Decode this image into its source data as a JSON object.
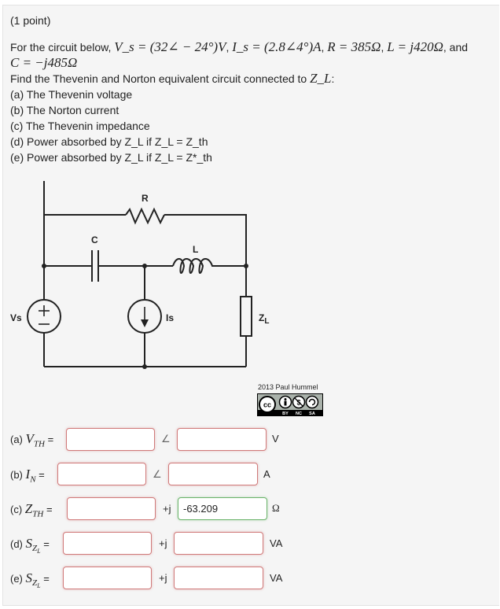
{
  "problem": {
    "points": "(1 point)",
    "intro_text": "For the circuit below,",
    "given": {
      "Vs": "V_s = (32∠ − 24°)V",
      "Is": "I_s = (2.8∠4°)A",
      "R": "R = 385Ω",
      "L": "L = j420Ω",
      "C": "C = −j485Ω",
      "and": "and"
    },
    "find_text": "Find the Thevenin and Norton equivalent circuit connected to",
    "find_target": "Z_L",
    "tasks": [
      "(a) The Thevenin voltage",
      "(b) The Norton current",
      "(c) The Thevenin impedance",
      "(d) Power absorbed by Z_L if Z_L = Z_th",
      "(e) Power absorbed by Z_L if Z_L = Z*_th"
    ]
  },
  "circuit": {
    "labels": {
      "R": "R",
      "C": "C",
      "L": "L",
      "Vs": "Vs",
      "Is": "Is",
      "ZL": "Z",
      "ZL_sub": "L"
    },
    "credit": "2013 Paul Hummel",
    "license": {
      "cc": "cc",
      "by": "BY",
      "nc": "NC",
      "sa": "SA"
    }
  },
  "answers": [
    {
      "prefix": "(a)",
      "symbol": "V",
      "sub": "TH",
      "eq": "=",
      "sep": "∠",
      "unit": "V",
      "field1": "",
      "field2": ""
    },
    {
      "prefix": "(b)",
      "symbol": "I",
      "sub": "N",
      "eq": "=",
      "sep": "∠",
      "unit": "A",
      "field1": "",
      "field2": ""
    },
    {
      "prefix": "(c)",
      "symbol": "Z",
      "sub": "TH",
      "eq": "=",
      "sep": "+j",
      "unit": "Ω",
      "field1": "",
      "field2": "-63.209"
    },
    {
      "prefix": "(d)",
      "symbol": "S",
      "sub": "Z_L",
      "eq": "=",
      "sep": "+j",
      "unit": "VA",
      "field1": "",
      "field2": ""
    },
    {
      "prefix": "(e)",
      "symbol": "S",
      "sub": "Z_L",
      "eq": "=",
      "sep": "+j",
      "unit": "VA",
      "field1": "",
      "field2": ""
    }
  ],
  "colors": {
    "error_border": "#d07a7a",
    "correct_border": "#6ab36a",
    "panel_bg": "#f5f5f5"
  }
}
